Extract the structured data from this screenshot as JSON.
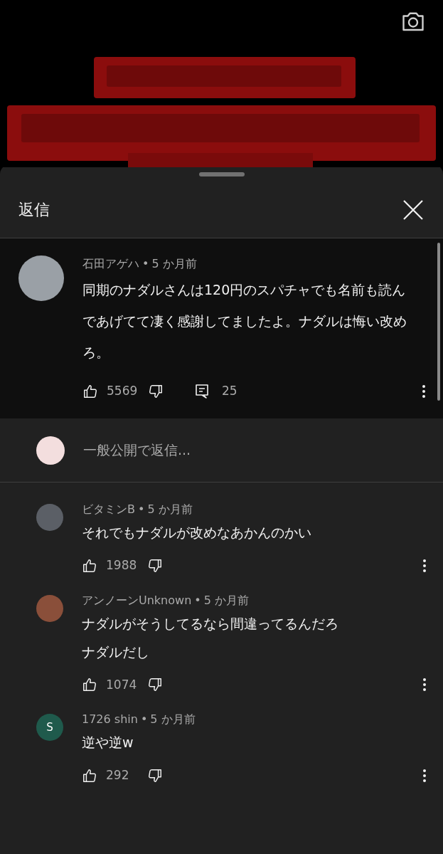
{
  "sheet": {
    "title": "返信"
  },
  "top_comment": {
    "author": "石田アゲハ",
    "dot": "•",
    "time": "5 か月前",
    "text": "同期のナダルさんは120円のスパチャでも名前も読んであげてて凄く感謝してましたよ。ナダルは悔い改めろ。",
    "likes": "5569",
    "replies": "25",
    "color": "#9aa0a6"
  },
  "reply_box": {
    "placeholder": "一般公開で返信...",
    "color": "#f3dede"
  },
  "replies": [
    {
      "author": "ビタミンB",
      "dot": "•",
      "time": "5 か月前",
      "text": [
        "それでもナダルが改めなあかんのかい"
      ],
      "likes": "1988",
      "color": "#5b5f66"
    },
    {
      "author": "アンノーンUnknown",
      "dot": "•",
      "time": "5 か月前",
      "text": [
        "ナダルがそうしてるなら間違ってるんだろ",
        "ナダルだし"
      ],
      "likes": "1074",
      "color": "#8a4f3a"
    },
    {
      "author": "1726 shin",
      "dot": "•",
      "time": "5 か月前",
      "text": [
        "逆や逆w"
      ],
      "likes": "292",
      "color": "#1f5a4c",
      "letter": "S"
    }
  ]
}
